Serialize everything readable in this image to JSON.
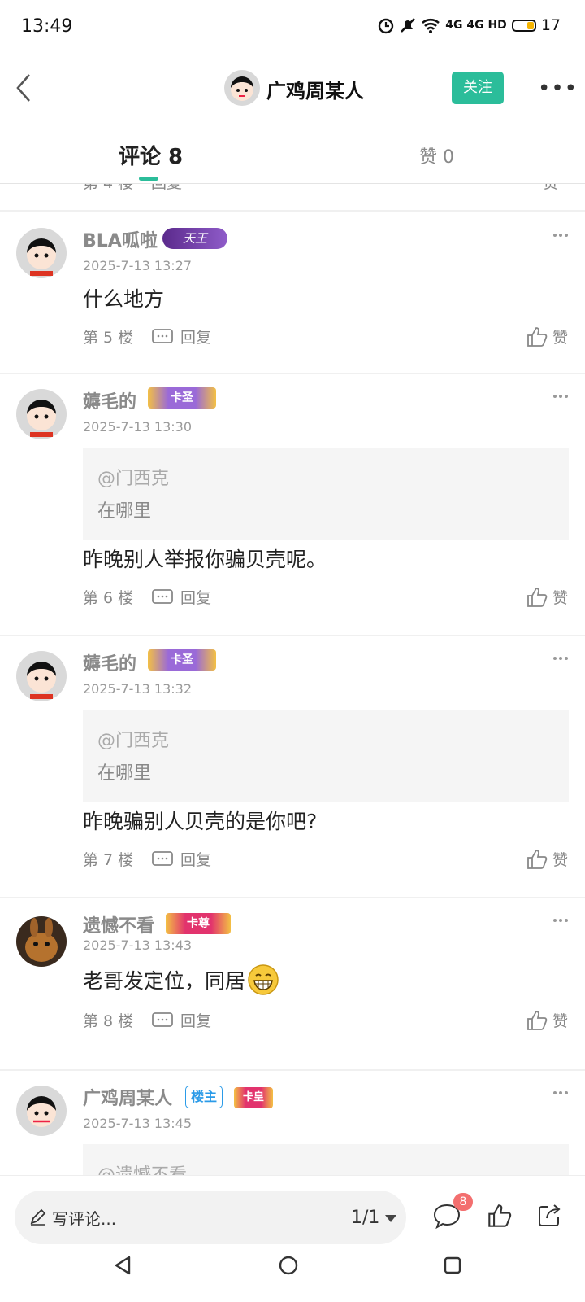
{
  "status": {
    "time": "13:49",
    "network": "4G 4G HD",
    "battery": "17"
  },
  "header": {
    "title": "广鸡周某人",
    "follow_label": "关注",
    "more_label": "•••"
  },
  "tabs": [
    {
      "label": "评论 8"
    },
    {
      "label": "赞 0"
    }
  ],
  "partial_row": {
    "floor": "第 4 楼",
    "reply": "回复",
    "like": "赞"
  },
  "comments": [
    {
      "user": "BLA呱啦",
      "badge": "天王",
      "time": "2025-7-13 13:27",
      "quote_at": "",
      "quote_text": "",
      "content": "什么地方",
      "floor": "第 5 楼",
      "reply": "回复",
      "like": "赞"
    },
    {
      "user": "薅毛的",
      "badge": "卡圣",
      "time": "2025-7-13 13:30",
      "quote_at": "@门西克",
      "quote_text": "在哪里",
      "content": "昨晚别人举报你骗贝壳呢。",
      "floor": "第 6 楼",
      "reply": "回复",
      "like": "赞"
    },
    {
      "user": "薅毛的",
      "badge": "卡圣",
      "time": "2025-7-13 13:32",
      "quote_at": "@门西克",
      "quote_text": "在哪里",
      "content": "昨晚骗别人贝壳的是你吧?",
      "floor": "第 7 楼",
      "reply": "回复",
      "like": "赞"
    },
    {
      "user": "遗憾不看",
      "badge": "卡尊",
      "time": "2025-7-13 13:43",
      "quote_at": "",
      "quote_text": "",
      "content": "老哥发定位，同居",
      "floor": "第 8 楼",
      "reply": "回复",
      "like": "赞"
    },
    {
      "user": "广鸡周某人",
      "host_badge": "楼主",
      "badge": "卡皇",
      "time": "2025-7-13 13:45",
      "quote_at": "@遗憾不看"
    }
  ],
  "bottom": {
    "write_placeholder": "写评论...",
    "page": "1/1",
    "comment_count": "8"
  },
  "colors": {
    "accent": "#2bbd9a",
    "badge_red": "#f36f6f",
    "host_blue": "#2b9be8"
  }
}
